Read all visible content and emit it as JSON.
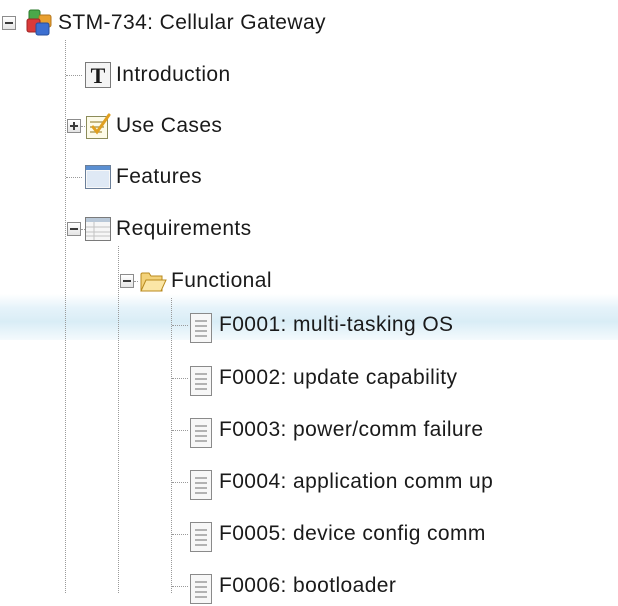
{
  "tree": {
    "root": {
      "label": "STM-734: Cellular Gateway",
      "expanded": true,
      "icon": "colored-cubes-icon"
    },
    "children": [
      {
        "label": "Introduction",
        "icon": "text-t-icon"
      },
      {
        "label": "Use Cases",
        "icon": "checklist-icon",
        "expanded": false
      },
      {
        "label": "Features",
        "icon": "window-icon"
      },
      {
        "label": "Requirements",
        "icon": "table-icon",
        "expanded": true
      },
      {
        "label": "Functional",
        "icon": "open-folder-icon",
        "expanded": true
      }
    ],
    "requirements": [
      {
        "label": "F0001: multi-tasking OS",
        "icon": "document-icon"
      },
      {
        "label": "F0002: update capability",
        "icon": "document-icon"
      },
      {
        "label": "F0003: power/comm failure",
        "icon": "document-icon"
      },
      {
        "label": "F0004: application comm up",
        "icon": "document-icon"
      },
      {
        "label": "F0005: device config comm",
        "icon": "document-icon"
      },
      {
        "label": "F0006: bootloader",
        "icon": "document-icon"
      }
    ]
  }
}
